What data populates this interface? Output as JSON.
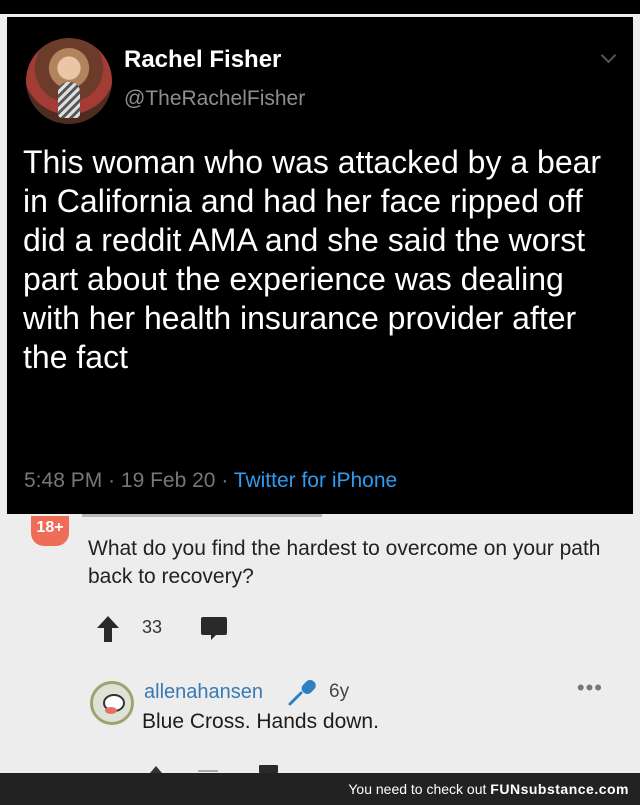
{
  "tweet": {
    "display_name": "Rachel Fisher",
    "handle": "@TheRachelFisher",
    "text": "This woman who was attacked by a bear in California and had her face ripped off did a reddit AMA and she said the worst part about the experience was dealing with her health insurance provider after the fact",
    "time": "5:48 PM",
    "date": "19 Feb 20",
    "separator": "·",
    "source": "Twitter for iPhone"
  },
  "reddit": {
    "nsfw_badge": "18+",
    "question": "What do you find the hardest to overcome on your path back to recovery?",
    "upvotes": "33",
    "reply": {
      "username": "allenahansen",
      "age": "6y",
      "text": "Blue Cross. Hands down."
    }
  },
  "footer": {
    "prefix": "You need to check out",
    "brand": "FUNsubstance.com"
  },
  "colors": {
    "tweet_background": "#000000",
    "reddit_background": "#ededed",
    "twitter_link": "#2f9bf0",
    "reddit_username": "#387ab2",
    "nsfw_badge": "#ef6c56",
    "footer_background": "#222222"
  },
  "icons": [
    "chevron-down-icon",
    "upvote-arrow-icon",
    "comment-icon",
    "microphone-icon",
    "more-options-icon"
  ]
}
